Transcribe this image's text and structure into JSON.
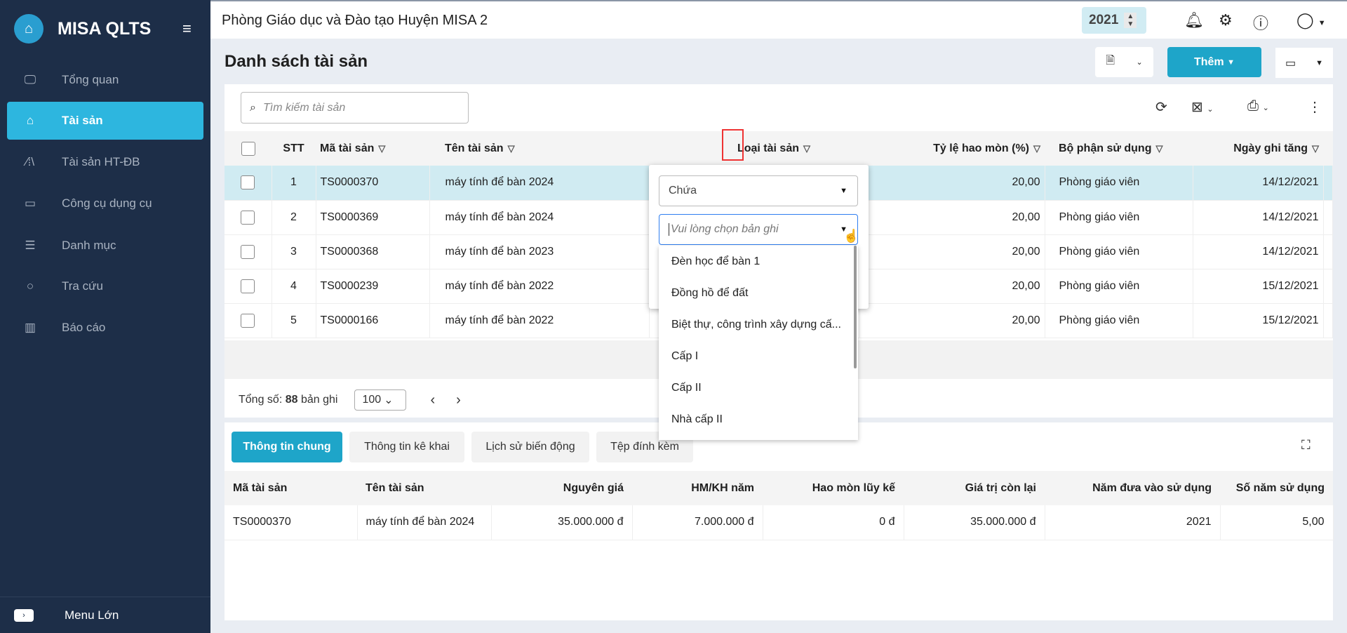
{
  "app": {
    "name": "MISA QLTS",
    "menu_toggle": "Menu Lớn"
  },
  "sidebar": {
    "items": [
      {
        "label": "Tổng quan",
        "icon": "monitor-chart-icon"
      },
      {
        "label": "Tài sản",
        "icon": "house-car-icon",
        "active": true
      },
      {
        "label": "Tài sản HT-ĐB",
        "icon": "road-icon"
      },
      {
        "label": "Công cụ dụng cụ",
        "icon": "paint-roller-icon"
      },
      {
        "label": "Danh mục",
        "icon": "list-icon"
      },
      {
        "label": "Tra cứu",
        "icon": "search-icon"
      },
      {
        "label": "Báo cáo",
        "icon": "bar-chart-icon"
      }
    ]
  },
  "header": {
    "org": "Phòng Giáo dục và Đào tạo Huyện MISA 2",
    "year": "2021"
  },
  "page": {
    "title": "Danh sách tài sản",
    "add_label": "Thêm"
  },
  "search": {
    "placeholder": "Tìm kiếm tài sản"
  },
  "grid": {
    "columns": [
      "STT",
      "Mã tài sản",
      "Tên tài sản",
      "Loại tài sản",
      "Tỷ lệ hao mòn (%)",
      "Bộ phận sử dụng",
      "Ngày ghi tăng"
    ],
    "rows": [
      {
        "stt": "1",
        "code": "TS0000370",
        "name": "máy tính để bàn 2024",
        "rate": "20,00",
        "dept": "Phòng giáo viên",
        "date": "14/12/2021"
      },
      {
        "stt": "2",
        "code": "TS0000369",
        "name": "máy tính để bàn 2024",
        "rate": "20,00",
        "dept": "Phòng giáo viên",
        "date": "14/12/2021"
      },
      {
        "stt": "3",
        "code": "TS0000368",
        "name": "máy tính để bàn 2023",
        "rate": "20,00",
        "dept": "Phòng giáo viên",
        "date": "14/12/2021"
      },
      {
        "stt": "4",
        "code": "TS0000239",
        "name": "máy tính để bàn 2022",
        "rate": "20,00",
        "dept": "Phòng giáo viên",
        "date": "15/12/2021"
      },
      {
        "stt": "5",
        "code": "TS0000166",
        "name": "máy tính để bàn 2022",
        "rate": "20,00",
        "dept": "Phòng giáo viên",
        "date": "15/12/2021"
      }
    ]
  },
  "pager": {
    "total_prefix": "Tổng số:",
    "total": "88",
    "total_suffix": "bản ghi",
    "page_size": "100"
  },
  "filter": {
    "operator": "Chứa",
    "placeholder": "Vui lòng chọn bản ghi",
    "options": [
      "Đèn học để bàn 1",
      "Đồng hồ để đất",
      "Biệt thự, công trình xây dựng cấ...",
      "Cấp I",
      "Cấp II",
      "Nhà cấp II"
    ]
  },
  "detail": {
    "tabs": [
      "Thông tin chung",
      "Thông tin kê khai",
      "Lịch sử biến động",
      "Tệp đính kèm"
    ],
    "columns": [
      "Mã tài sản",
      "Tên tài sản",
      "Nguyên giá",
      "HM/KH năm",
      "Hao mòn lũy kế",
      "Giá trị còn lại",
      "Năm đưa vào sử dụng",
      "Số năm sử dụng"
    ],
    "row": [
      "TS0000370",
      "máy tính để bàn 2024",
      "35.000.000 đ",
      "7.000.000 đ",
      "0 đ",
      "35.000.000 đ",
      "2021",
      "5,00"
    ]
  },
  "colors": {
    "sidebar": "#1d2e48",
    "accent": "#1ea5c9",
    "selected_row": "#d0ebf2",
    "highlight": "#e33333"
  }
}
